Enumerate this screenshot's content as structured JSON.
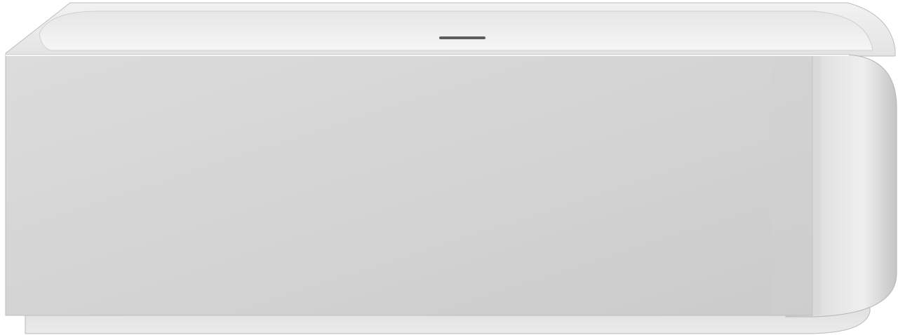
{
  "image": {
    "subject": "bathtub-product-render",
    "colors": {
      "background": "#ffffff",
      "front_panel": "#d5d5d5",
      "rim": "#e9e9e9",
      "basin": "#f2f2f2",
      "overflow_drain": "#5e5e5e"
    }
  }
}
